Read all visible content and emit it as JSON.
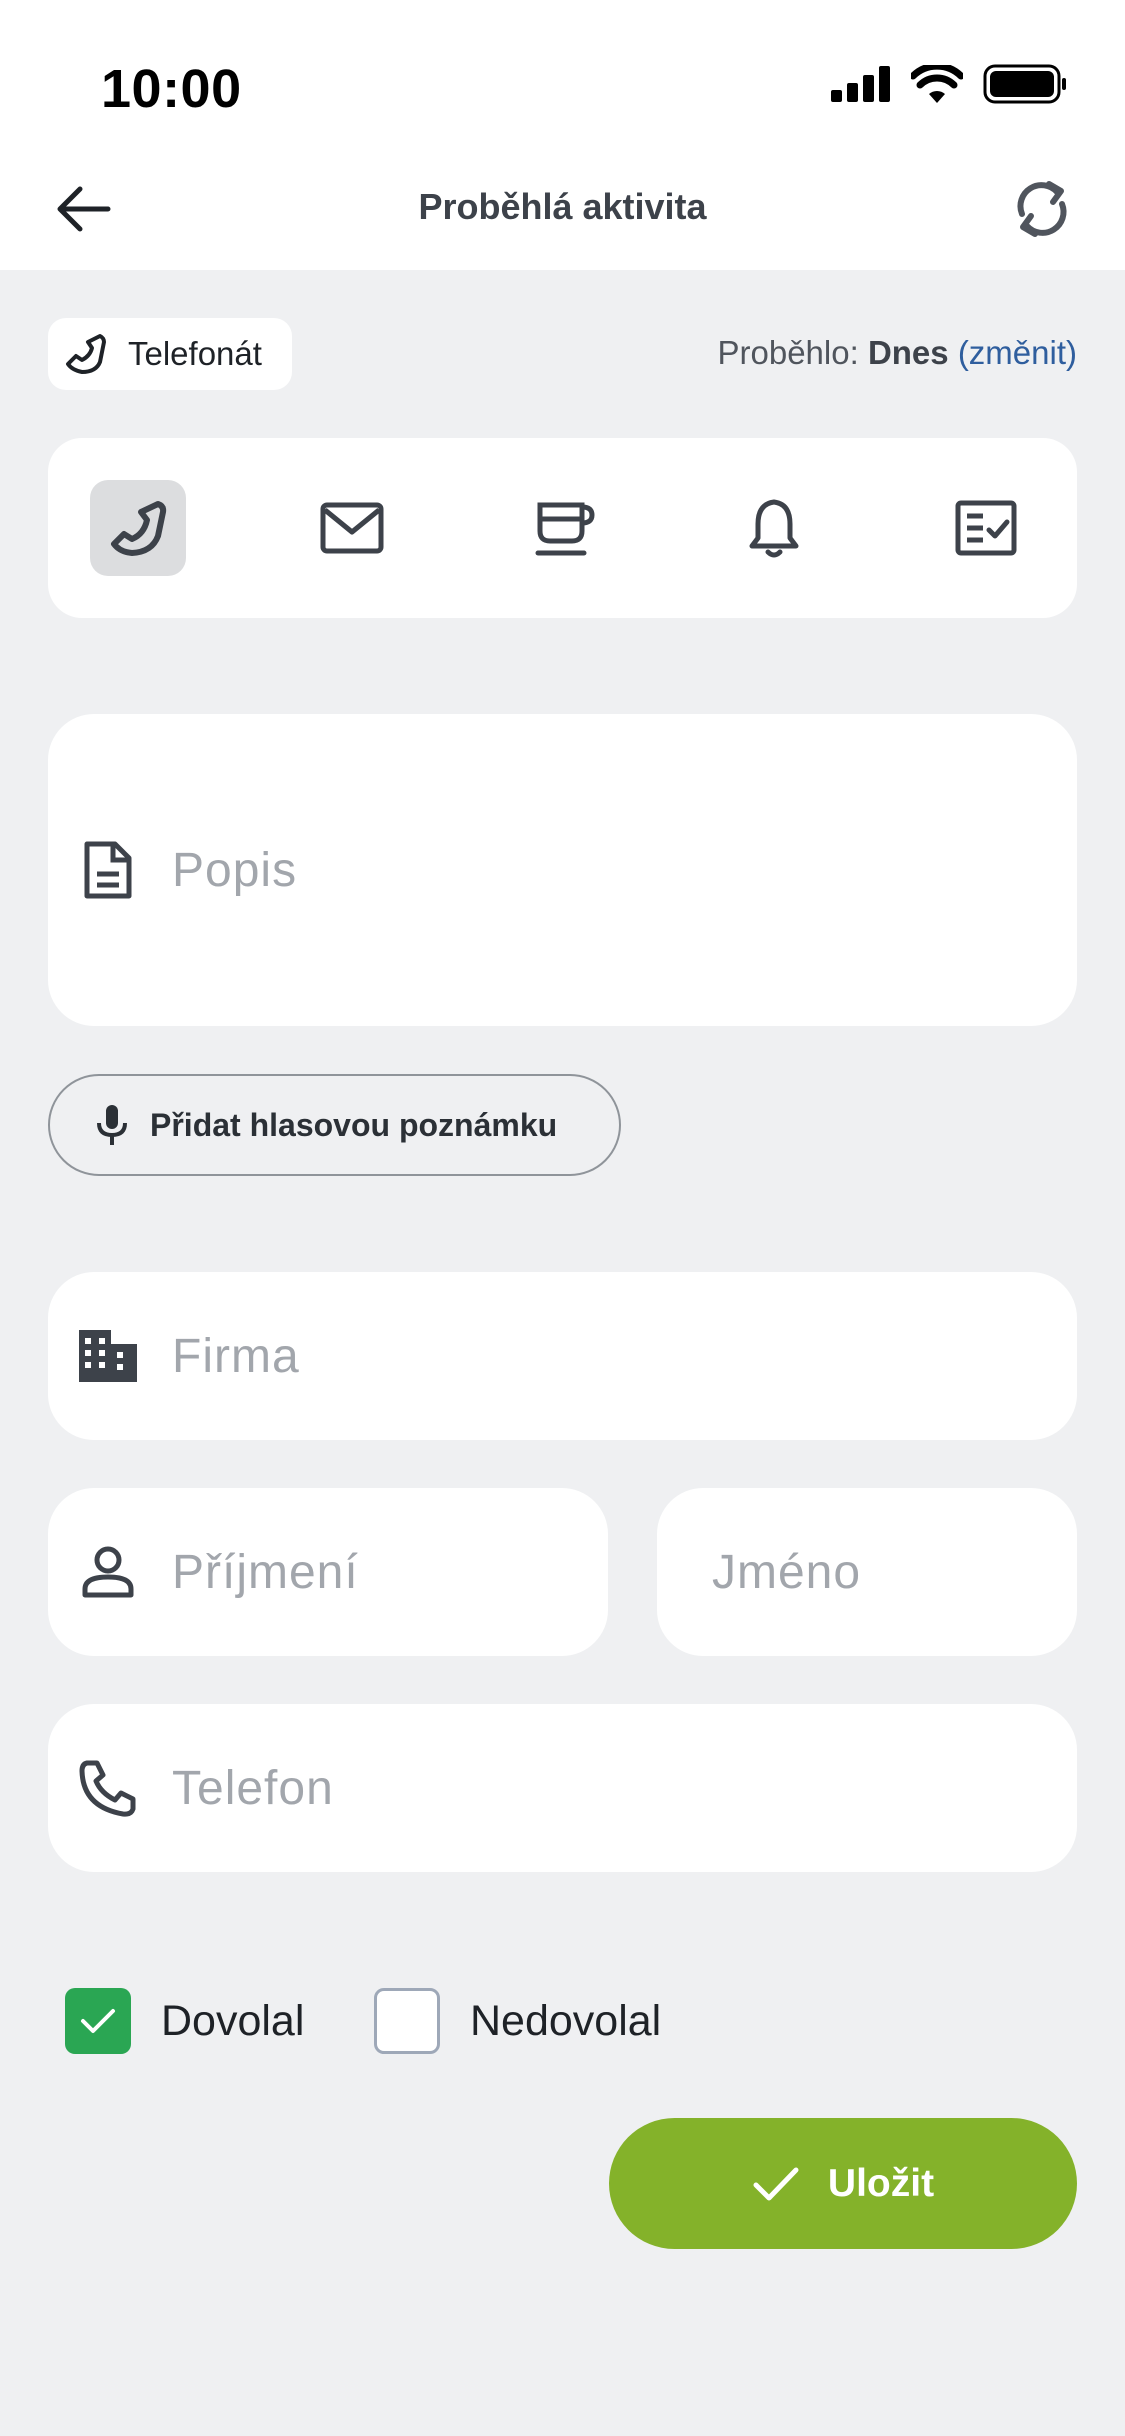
{
  "status_bar": {
    "time": "10:00"
  },
  "header": {
    "title": "Proběhlá aktivita"
  },
  "activity": {
    "type_label": "Telefonát",
    "happened_prefix": "Proběhlo:",
    "happened_value": "Dnes",
    "change_link": "(změnit)"
  },
  "activity_types": [
    {
      "icon": "phone-icon",
      "active": true
    },
    {
      "icon": "email-icon",
      "active": false
    },
    {
      "icon": "coffee-cup-icon",
      "active": false
    },
    {
      "icon": "bell-icon",
      "active": false
    },
    {
      "icon": "checklist-icon",
      "active": false
    }
  ],
  "form": {
    "description_placeholder": "Popis",
    "voice_note_label": "Přidat hlasovou poznámku",
    "company_placeholder": "Firma",
    "surname_placeholder": "Příjmení",
    "name_placeholder": "Jméno",
    "phone_placeholder": "Telefon"
  },
  "call_result": {
    "reached_label": "Dovolal",
    "reached_checked": true,
    "not_reached_label": "Nedovolal",
    "not_reached_checked": false
  },
  "actions": {
    "save_label": "Uložit"
  },
  "colors": {
    "accent_green": "#84b22a",
    "checkbox_green": "#2aa653",
    "link_blue": "#2f5e9e",
    "background": "#eff0f2"
  }
}
